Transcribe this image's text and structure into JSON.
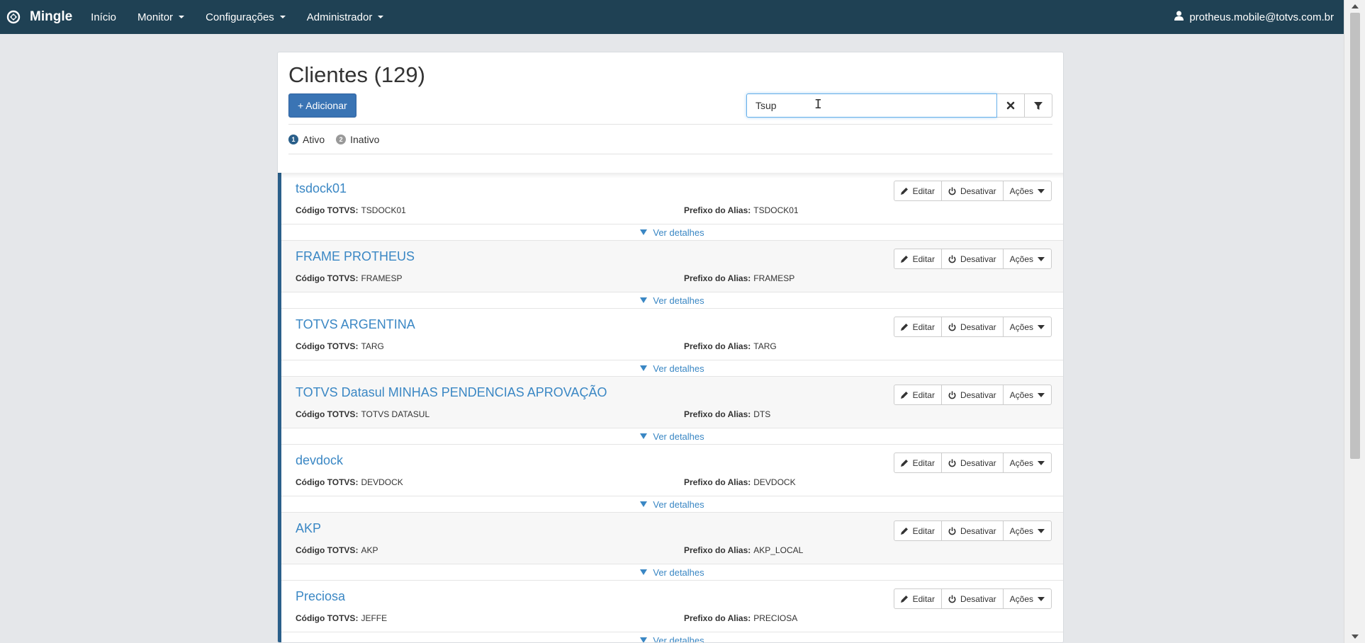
{
  "navbar": {
    "brand": "Mingle",
    "items": [
      {
        "label": "Início",
        "dropdown": false
      },
      {
        "label": "Monitor",
        "dropdown": true
      },
      {
        "label": "Configurações",
        "dropdown": true
      },
      {
        "label": "Administrador",
        "dropdown": true
      }
    ],
    "user": "protheus.mobile@totvs.com.br"
  },
  "page": {
    "title": "Clientes (129)",
    "add_label": "+ Adicionar",
    "search_value": "Tsup",
    "status": [
      {
        "count": "1",
        "label": "Ativo",
        "color": "#2a5f8a"
      },
      {
        "count": "2",
        "label": "Inativo",
        "color": "#999999"
      }
    ]
  },
  "labels": {
    "code": "Código TOTVS:",
    "alias": "Prefixo do Alias:",
    "edit": "Editar",
    "deactivate": "Desativar",
    "actions": "Ações",
    "details": "Ver detalhes"
  },
  "clients": [
    {
      "name": "tsdock01",
      "code": "TSDOCK01",
      "alias": "TSDOCK01"
    },
    {
      "name": "FRAME PROTHEUS",
      "code": "FRAMESP",
      "alias": "FRAMESP"
    },
    {
      "name": "TOTVS ARGENTINA",
      "code": "TARG",
      "alias": "TARG"
    },
    {
      "name": "TOTVS Datasul MINHAS PENDENCIAS APROVAÇÃO",
      "code": "TOTVS DATASUL",
      "alias": "DTS"
    },
    {
      "name": "devdock",
      "code": "DEVDOCK",
      "alias": "DEVDOCK"
    },
    {
      "name": "AKP",
      "code": "AKP",
      "alias": "AKP_LOCAL"
    },
    {
      "name": "Preciosa",
      "code": "JEFFE",
      "alias": "PRECIOSA"
    }
  ]
}
